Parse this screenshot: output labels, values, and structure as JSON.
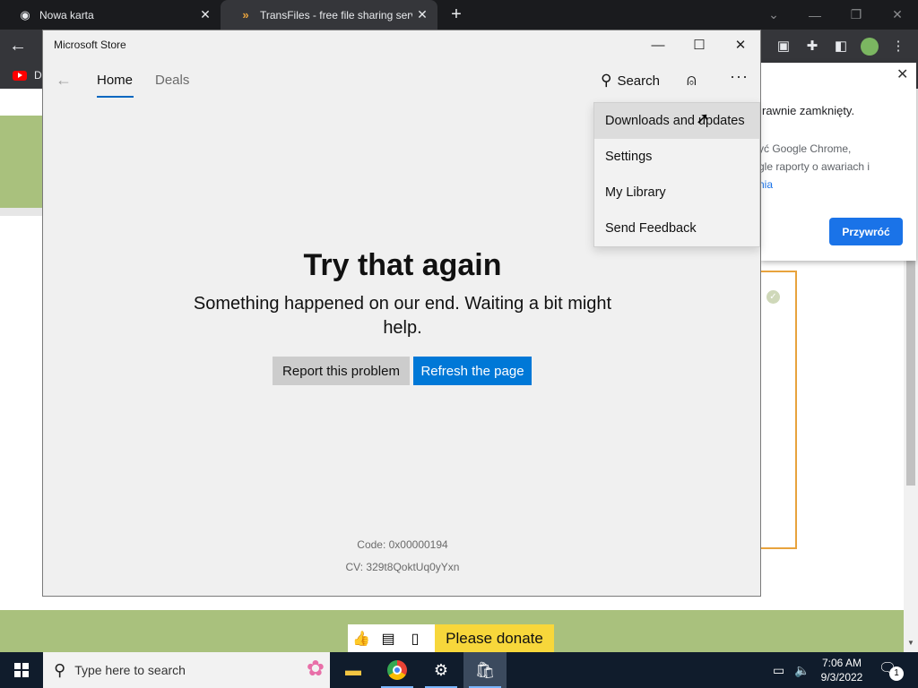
{
  "browser": {
    "tabs": [
      {
        "title": "Nowa karta",
        "icon": "chrome-icon",
        "active": false
      },
      {
        "title": "TransFiles - free file sharing servic",
        "icon": "transfiles-icon",
        "active": true
      }
    ],
    "bookmark_label": "D",
    "popup": {
      "title": "rawnie zamknięty.",
      "body_line1": "yć Google Chrome,",
      "body_line2": "gle raporty o awariach i",
      "body_link": "nia",
      "button": "Przywróć"
    },
    "donate_label": "Please donate"
  },
  "store": {
    "window_title": "Microsoft Store",
    "nav": {
      "home": "Home",
      "deals": "Deals",
      "search": "Search"
    },
    "menu": [
      {
        "label": "Downloads and updates",
        "hover": true
      },
      {
        "label": "Settings",
        "hover": false
      },
      {
        "label": "My Library",
        "hover": false
      },
      {
        "label": "Send Feedback",
        "hover": false
      }
    ],
    "error": {
      "title": "Try that again",
      "message": "Something happened on our end. Waiting a bit might help.",
      "report_button": "Report this problem",
      "refresh_button": "Refresh the page",
      "code": "Code: 0x00000194",
      "cv": "CV: 329t8QoktUq0yYxn"
    }
  },
  "taskbar": {
    "search_placeholder": "Type here to search",
    "time": "7:06 AM",
    "date": "9/3/2022",
    "notification_count": "1"
  },
  "colors": {
    "accent": "#0078d7",
    "chrome_dark": "#35363a",
    "page_green": "#a9c17d",
    "donate_yellow": "#f7d73b",
    "taskbar": "#101c2c"
  }
}
